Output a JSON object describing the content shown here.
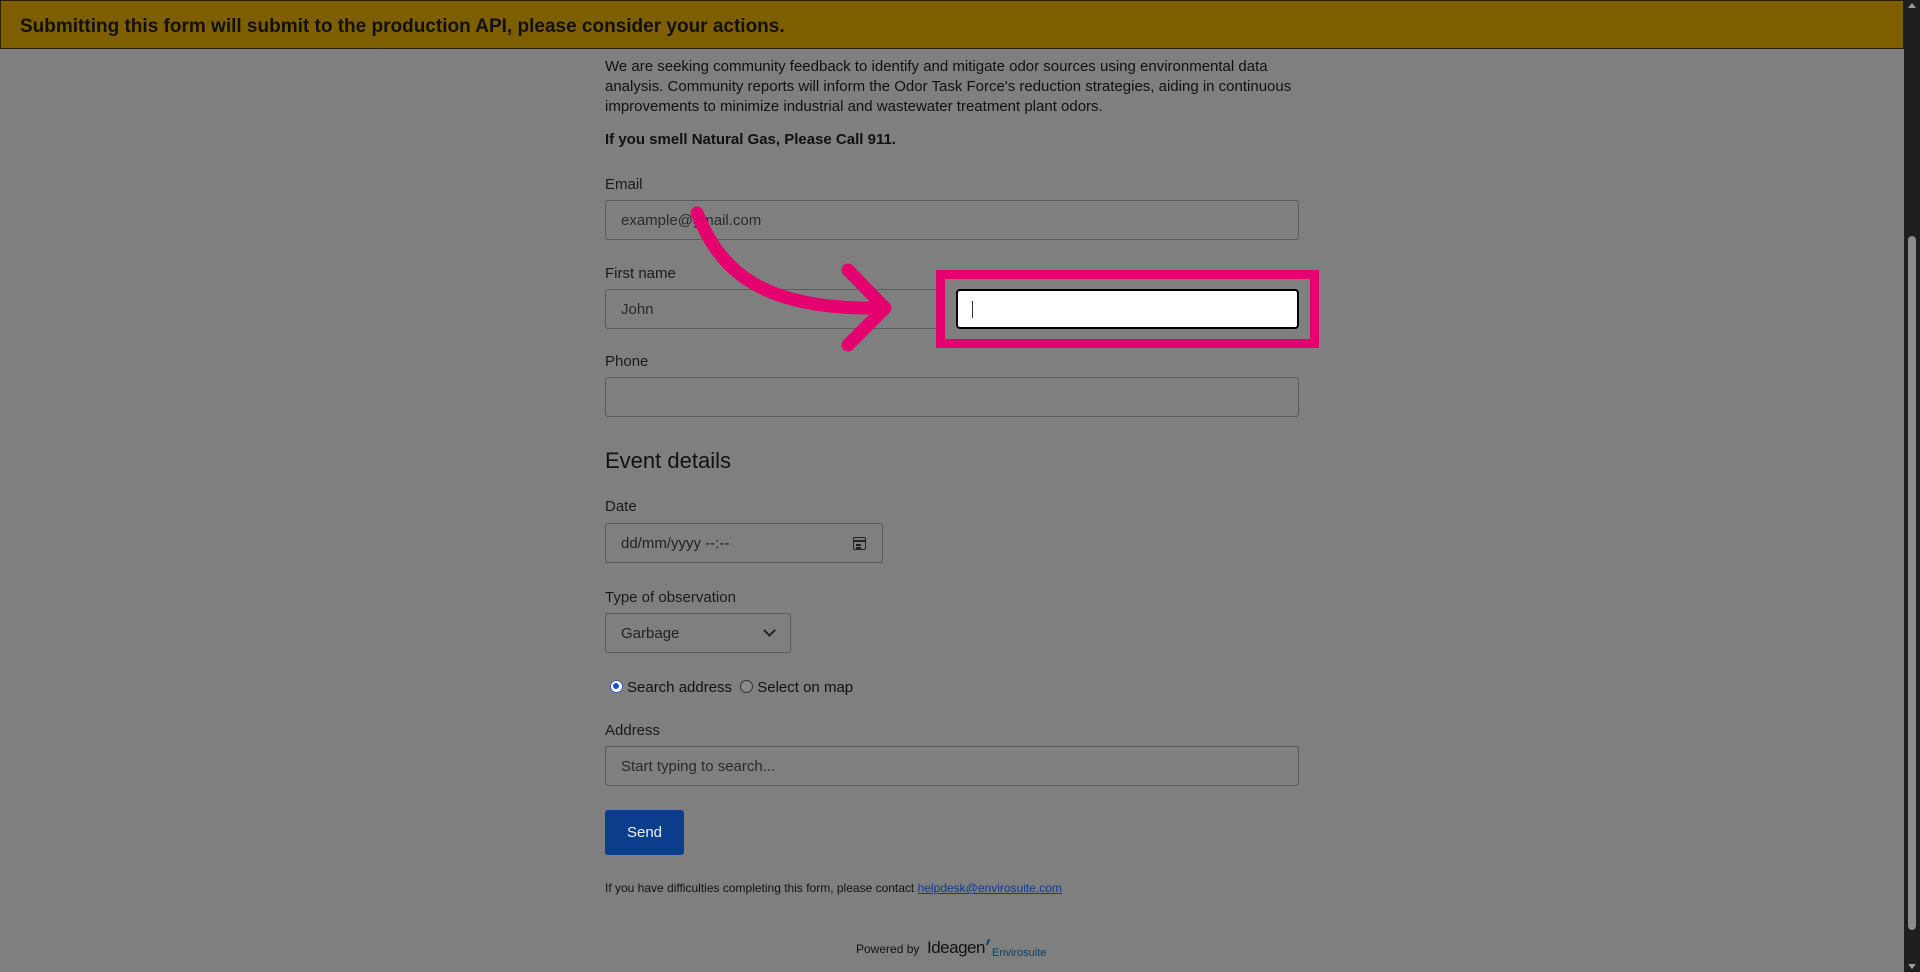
{
  "banner": {
    "text": "Submitting this form will submit to the production API, please consider your actions."
  },
  "intro": {
    "text": "We are seeking community feedback to identify and mitigate odor sources using environmental data analysis. Community reports will inform the Odor Task Force's reduction strategies, aiding in continuous improvements to minimize industrial and wastewater treatment plant odors.",
    "gas_warning": "If you smell Natural Gas, Please Call 911."
  },
  "contact": {
    "email_label": "Email",
    "email_placeholder": "example@gmail.com",
    "first_name_label": "First name",
    "first_name_placeholder": "John",
    "last_name_value": "",
    "phone_label": "Phone",
    "phone_value": ""
  },
  "event": {
    "section_title": "Event details",
    "date_label": "Date",
    "date_placeholder": "dd/mm/yyyy --:--",
    "observation_label": "Type of observation",
    "observation_selected": "Garbage",
    "location_options": [
      "Search address",
      "Select on map"
    ],
    "location_selected": "Search address",
    "address_label": "Address",
    "address_placeholder": "Start typing to search..."
  },
  "actions": {
    "send_label": "Send"
  },
  "footer": {
    "help_text": "If you have difficulties completing this form, please contact",
    "help_email": "helpdesk@envirosuite.com",
    "powered_by": "Powered by",
    "logo_brand": "Ideagen",
    "logo_product": "Envirosuite"
  },
  "annotation": {
    "highlight_color": "#e4006f"
  },
  "colors": {
    "banner": "#7e5f00",
    "send_button": "#0a3d8c",
    "overlay": "#7f7f7f"
  }
}
